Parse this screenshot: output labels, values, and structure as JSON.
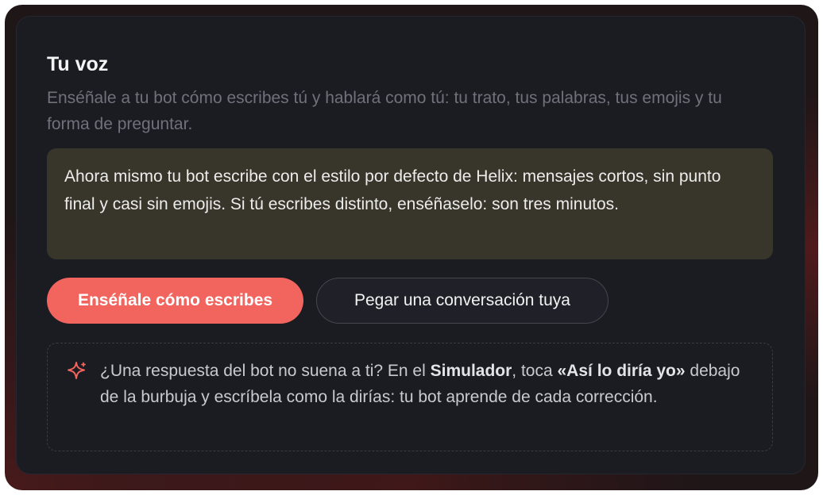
{
  "voice_card": {
    "title": "Tu voz",
    "subtitle": "Enséñale a tu bot cómo escribes tú y hablará como tú: tu trato, tus palabras, tus emojis y tu forma de preguntar.",
    "notice": "Ahora mismo tu bot escribe con el estilo por defecto de Helix: mensajes cortos, sin punto final y casi sin emojis. Si tú escribes distinto, enséñaselo: son tres minutos.",
    "primary_button": "Enséñale cómo escribes",
    "secondary_button": "Pegar una conversación tuya",
    "tip": {
      "icon": "sparkle-icon",
      "part1": "¿Una respuesta del bot no suena a ti? En el ",
      "simulator": "Simulador",
      "part2": ", toca ",
      "phrase": "«Así lo diría yo»",
      "part3": " debajo de la burbuja y escríbela como la dirías: tu bot aprende de cada corrección."
    }
  },
  "colors": {
    "accent": "#f2645e",
    "card_bg": "#1b1c22",
    "notice_bg": "#38362a"
  }
}
